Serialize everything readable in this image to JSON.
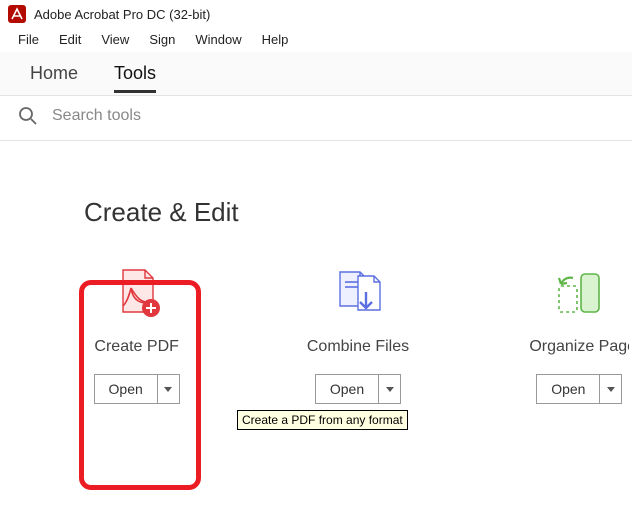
{
  "title_text": "Adobe Acrobat Pro DC (32-bit)",
  "menu": {
    "file": "File",
    "edit": "Edit",
    "view": "View",
    "sign": "Sign",
    "window": "Window",
    "help": "Help"
  },
  "tabs": {
    "home": "Home",
    "tools": "Tools"
  },
  "search": {
    "placeholder": "Search tools"
  },
  "section": {
    "title": "Create & Edit"
  },
  "tools": {
    "create_pdf": {
      "label": "Create PDF",
      "open": "Open"
    },
    "combine": {
      "label": "Combine Files",
      "open": "Open"
    },
    "organize": {
      "label": "Organize Pages",
      "open": "Open"
    }
  },
  "tooltip": "Create a PDF from any format"
}
